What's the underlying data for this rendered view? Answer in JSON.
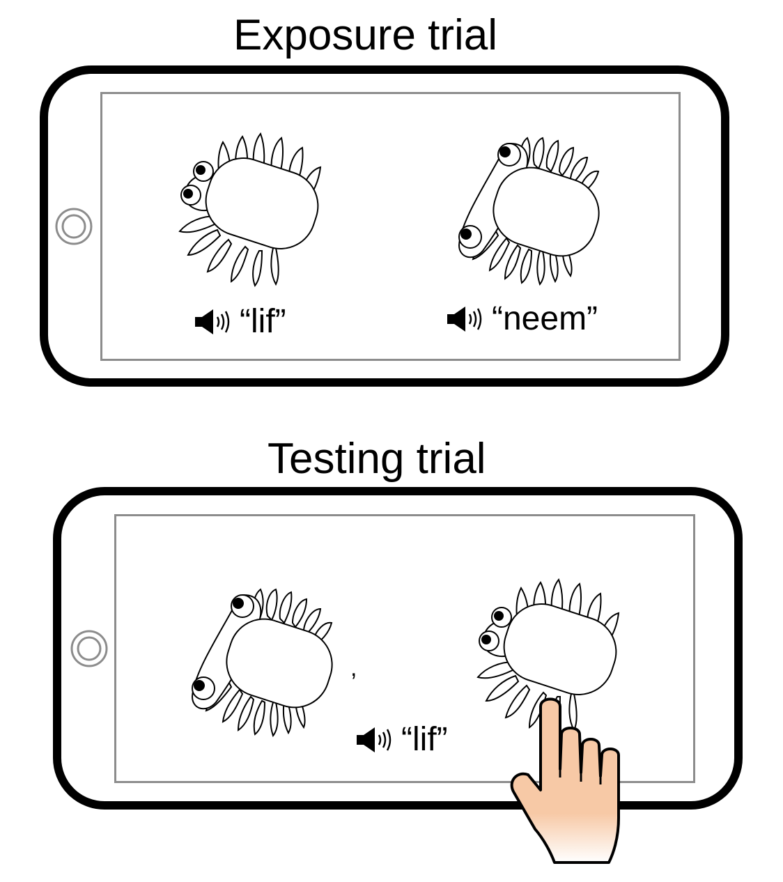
{
  "exposure": {
    "title": "Exposure trial",
    "left_word": "“lif”",
    "right_word": "“neem”"
  },
  "testing": {
    "title": "Testing trial",
    "stray_mark": ",",
    "word": "“lif”"
  },
  "colors": {
    "phone_frame": "#000000",
    "screen_border": "#8c8c8c",
    "hand_skin": "#f7c9a6"
  },
  "icons": [
    "home-button-icon",
    "speaker-icon",
    "creature-illustration",
    "pointing-hand-icon"
  ]
}
